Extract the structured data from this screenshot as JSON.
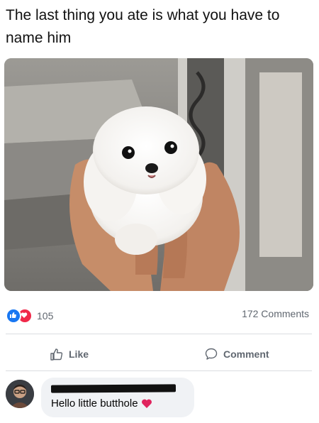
{
  "post": {
    "text": "The last thing you ate is what you have to name him"
  },
  "photo": {
    "icon": "puppy-photo"
  },
  "stats": {
    "reactions_count": "105",
    "comments_count": "172 Comments"
  },
  "actions": {
    "like_label": "Like",
    "comment_label": "Comment"
  },
  "comment": {
    "text": "Hello little butthole",
    "emoji": "heart-icon"
  },
  "colors": {
    "like_blue": "#1877f2",
    "love_red": "#f02849",
    "bubble_bg": "#f0f2f5",
    "meta_gray": "#606770"
  }
}
